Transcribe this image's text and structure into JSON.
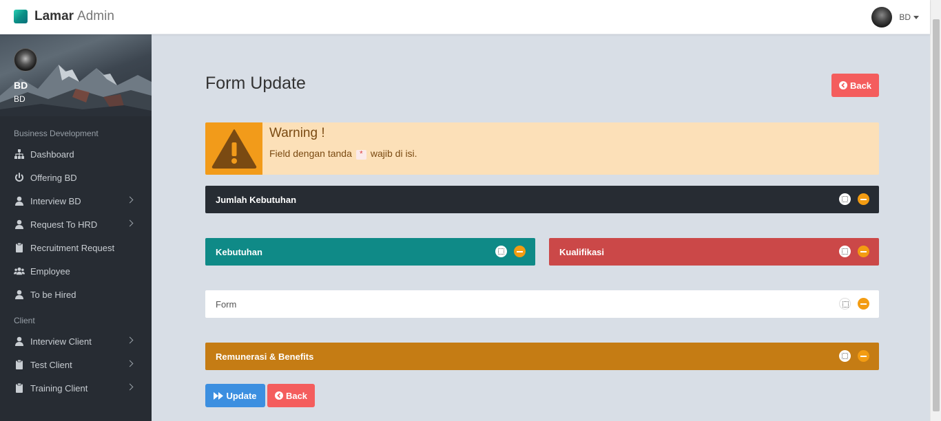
{
  "brand": {
    "name_bold": "Lamar",
    "name_light": "Admin"
  },
  "user": {
    "initials": "BD"
  },
  "sidebar": {
    "profile": {
      "name": "BD",
      "role": "BD"
    },
    "section_business": "Business Development",
    "business_items": [
      {
        "label": "Dashboard",
        "icon": "sitemap-icon",
        "has_submenu": false
      },
      {
        "label": "Offering BD",
        "icon": "power-icon",
        "has_submenu": false
      },
      {
        "label": "Interview BD",
        "icon": "user-icon",
        "has_submenu": true
      },
      {
        "label": "Request To HRD",
        "icon": "user-icon",
        "has_submenu": true
      },
      {
        "label": "Recruitment Request",
        "icon": "clipboard-icon",
        "has_submenu": false
      },
      {
        "label": "Employee",
        "icon": "users-icon",
        "has_submenu": false
      },
      {
        "label": "To be Hired",
        "icon": "user-icon",
        "has_submenu": false
      }
    ],
    "section_client": "Client",
    "client_items": [
      {
        "label": "Interview Client",
        "icon": "user-icon",
        "has_submenu": true
      },
      {
        "label": "Test Client",
        "icon": "clipboard-icon",
        "has_submenu": true
      },
      {
        "label": "Training Client",
        "icon": "clipboard-icon",
        "has_submenu": true
      }
    ]
  },
  "main": {
    "title": "Form Update",
    "back_label": "Back",
    "alert": {
      "title": "Warning !",
      "text_before": "Field dengan tanda",
      "required_mark": "*",
      "text_after": "wajib di isi."
    },
    "panels": {
      "jumlah": "Jumlah Kebutuhan",
      "kebutuhan": "Kebutuhan",
      "kualifikasi": "Kualifikasi",
      "form": "Form",
      "remunerasi": "Remunerasi & Benefits"
    },
    "update_label": "Update",
    "back_bottom_label": "Back"
  },
  "colors": {
    "sidebar": "#272c33",
    "teal_panel": "#0f8a87",
    "red_panel": "#cb4848",
    "orange_panel": "#c57c14",
    "warning_bg": "#fce0b8",
    "warning_icon_bg": "#f29b1a",
    "btn_red": "#f45d5d",
    "btn_blue": "#3c8fe0"
  }
}
